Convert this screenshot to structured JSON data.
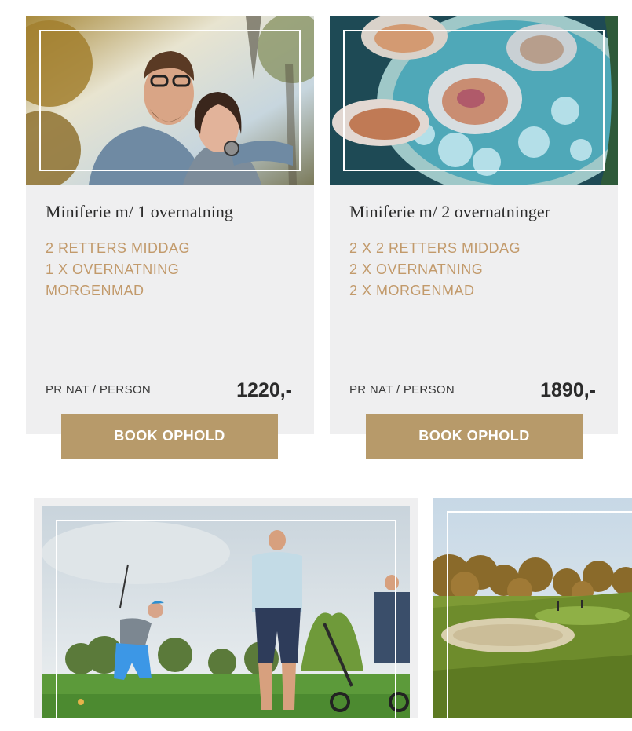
{
  "offers": [
    {
      "title": "Miniferie m/ 1 overnatning",
      "features": [
        "2 RETTERS MIDDAG",
        "1 X OVERNATNING",
        "MORGENMAD"
      ],
      "price_label": "PR NAT / PERSON",
      "price": "1220,-",
      "button_label": "BOOK OPHOLD",
      "image": "couple-photo"
    },
    {
      "title": "Miniferie m/ 2 overnatninger",
      "features": [
        "2 X 2 RETTERS MIDDAG",
        "2 X OVERNATNING",
        "2 X MORGENMAD"
      ],
      "price_label": "PR NAT / PERSON",
      "price": "1890,-",
      "button_label": "BOOK OPHOLD",
      "image": "oysters-photo"
    }
  ],
  "golf_cards": [
    {
      "image": "golfers-photo"
    },
    {
      "image": "golf-course-photo"
    }
  ],
  "colors": {
    "card_bg": "#efeff0",
    "accent_gold": "#b79a6a",
    "feature_text": "#c29a6b",
    "title_text": "#2b2b2b"
  }
}
